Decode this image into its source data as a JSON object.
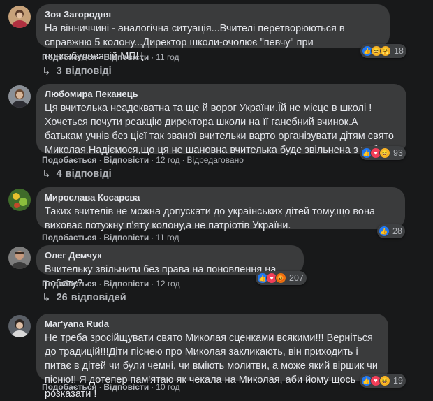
{
  "common": {
    "like": "Подобається",
    "reply": "Відповісти",
    "sep": "·"
  },
  "comments": [
    {
      "author": "Зоя Загородня",
      "text": "На вінниччині - аналогічна ситуація...Вчителі перетворюються в справжню 5 колону...Директор школи-очолює \"певчу\" при новозбудованій МПЦ",
      "time": "11 год",
      "reactions": [
        "like-icon",
        "haha-icon",
        "care-icon"
      ],
      "reaction_count": "18",
      "replies_count": "3",
      "replies_label": "відповіді"
    },
    {
      "author": "Любомира Пеканець",
      "text": "Ця вчителька неадекватна та ще й ворог України.Їй не місце в школі ! Хочеться почути реакцію директора школи на її ганебний вчинок.А батькам учнів без цієї так званої вчительки варто організувати дітям свято Миколая.Надіємося,що ця не шановна вчителька буде звільнена з роботи.",
      "time": "12 год",
      "edited": "Відредаговано",
      "reactions": [
        "like-icon",
        "love-icon",
        "haha-icon"
      ],
      "reaction_count": "93",
      "replies_count": "4",
      "replies_label": "відповіді"
    },
    {
      "author": "Мирослава Косарєва",
      "text": "Таких вчителів не можна допускати до українських дітей тому,що вона виховає потужну п'яту колону,а не патріотів України.",
      "time": "11 год",
      "reactions": [
        "like-icon"
      ],
      "reaction_count": "28"
    },
    {
      "author": "Олег Демчук",
      "text": "Вчительку звільнити без права на поновлення на роботу?",
      "time": "12 год",
      "reactions": [
        "like-icon",
        "love-icon",
        "angry-icon"
      ],
      "reaction_count": "207",
      "replies_count": "26",
      "replies_label": "відповідей"
    },
    {
      "author": "Mar'yana Ruda",
      "text": "Не треба зросійщувати свято Миколая сценками всякими!!! Верніться до традицій!!!Діти піснею про Миколая закликають, він приходить і питає в дітей чи були чемні, чи вміють молитви, а може який віршик чи пісню!! Я дотепер пам'ятаю як чекала на Миколая, аби йому щось розказати !",
      "time": "10 год",
      "reactions": [
        "like-icon",
        "love-icon",
        "haha-icon"
      ],
      "reaction_count": "19"
    }
  ]
}
